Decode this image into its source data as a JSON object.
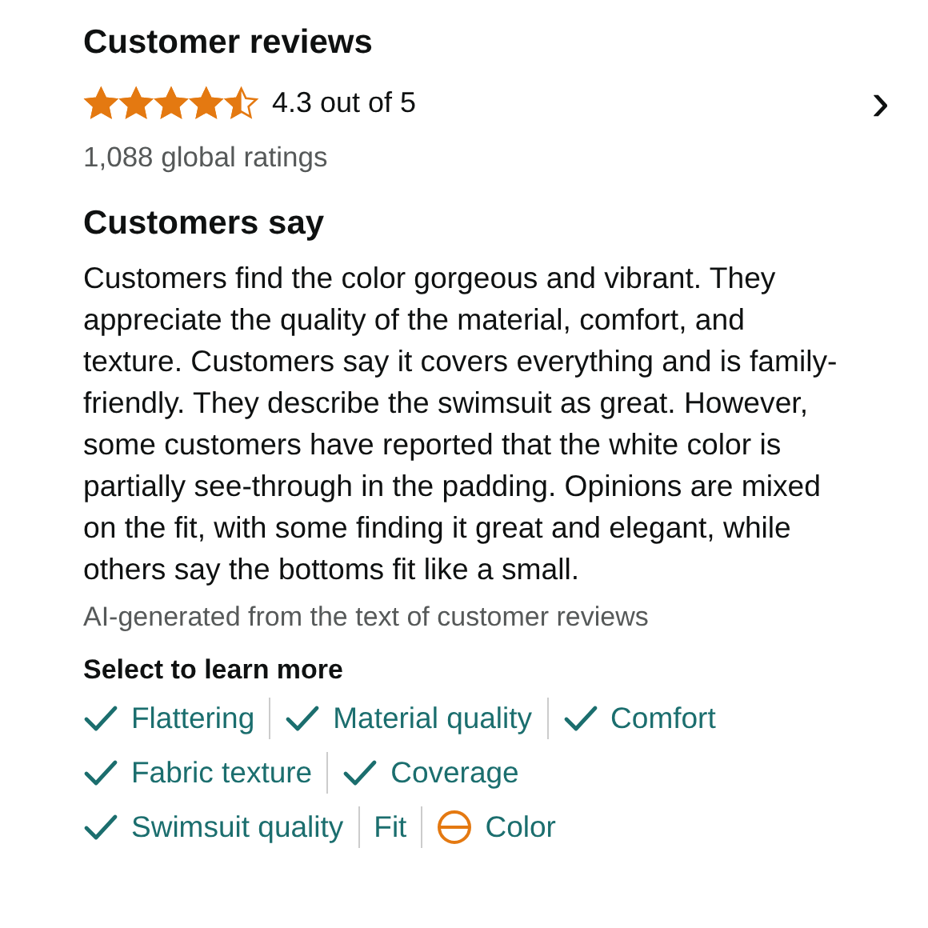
{
  "header": {
    "title": "Customer reviews",
    "stars": 4.5,
    "rating": "4.3 out of 5",
    "chevron": "›",
    "count": "1,088 global ratings"
  },
  "summary": {
    "title": "Customers say",
    "text": "Customers find the color gorgeous and vibrant. They appreciate the quality of the material, comfort, and texture. Customers say it covers everything and is family-friendly. They describe the swimsuit as great. However, some customers have reported that the white color is partially see-through in the padding. Opinions are mixed on the fit, with some finding it great and elegant, while others say the bottoms fit like a small.",
    "note": "AI-generated from the text of customer reviews"
  },
  "aspects_title": "Select to learn more",
  "aspect_rows": [
    [
      {
        "label": "Flattering",
        "kind": "positive"
      },
      {
        "label": "Material quality",
        "kind": "positive"
      },
      {
        "label": "Comfort",
        "kind": "positive"
      }
    ],
    [
      {
        "label": "Fabric texture",
        "kind": "positive"
      },
      {
        "label": "Coverage",
        "kind": "positive"
      }
    ],
    [
      {
        "label": "Swimsuit quality",
        "kind": "positive"
      },
      {
        "label": "Fit",
        "kind": "neutral"
      },
      {
        "label": "Color",
        "kind": "mixed"
      }
    ]
  ]
}
